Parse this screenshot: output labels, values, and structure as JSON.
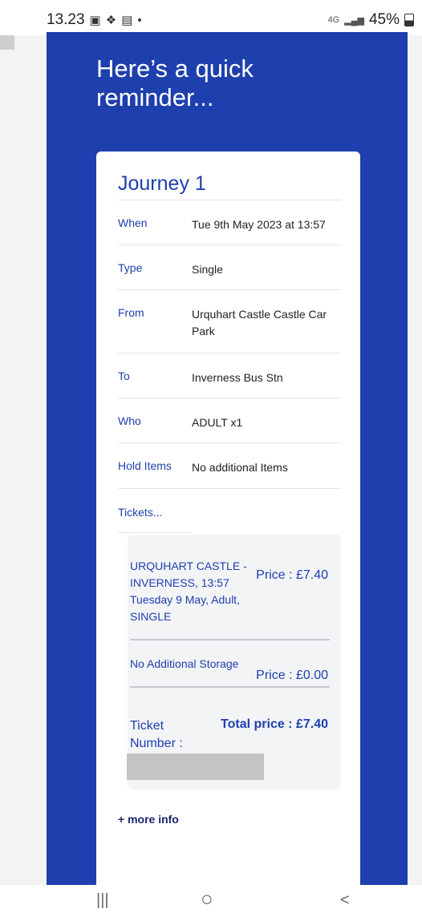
{
  "status_bar": {
    "time": "13.23",
    "network": "4G",
    "battery": "45%"
  },
  "email": {
    "headline": "Here’s a quick reminder...",
    "journey_title": "Journey 1",
    "rows": [
      {
        "label": "When",
        "value": "Tue 9th May 2023 at 13:57"
      },
      {
        "label": "Type",
        "value": "Single"
      },
      {
        "label": "From",
        "value": "Urquhart Castle Castle Car Park"
      },
      {
        "label": "To",
        "value": "Inverness Bus Stn"
      },
      {
        "label": "Who",
        "value": "ADULT x1"
      },
      {
        "label": "Hold Items",
        "value": "No additional Items"
      }
    ],
    "tickets_label": "Tickets...",
    "ticket": {
      "name": "URQUHART CASTLE - INVERNESS, 13:57 Tuesday 9 May, Adult, SINGLE",
      "price": "Price : £7.40",
      "storage": "No Additional Storage",
      "storage_price": "Price : £0.00",
      "ticket_number_label": "Ticket Number :",
      "total": "Total price : £7.40"
    },
    "more_info": "+ more info"
  },
  "nav": {
    "recent": "|||",
    "home": "○",
    "back": "<"
  }
}
